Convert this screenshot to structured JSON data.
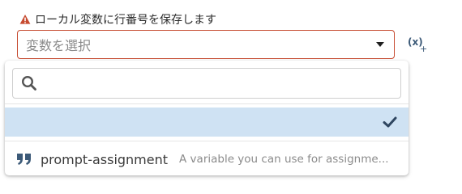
{
  "field": {
    "label": "ローカル変数に行番号を保存します",
    "label_icon": "warning-icon",
    "placeholder": "変数を選択",
    "caret_icon": "caret-down-icon",
    "insert_variable_glyph": "(x)",
    "insert_variable_plus": "+",
    "error_color": "#c64a2f"
  },
  "dropdown": {
    "search": {
      "icon": "search-icon",
      "value": "",
      "placeholder": ""
    },
    "options": [
      {
        "name": "",
        "description": "",
        "selected": true,
        "icon": "check-icon"
      },
      {
        "name": "prompt-assignment",
        "description": "A variable you can use for assignme...",
        "selected": false,
        "icon": "quote-icon"
      }
    ],
    "selected_color": "#cfe2f3"
  }
}
